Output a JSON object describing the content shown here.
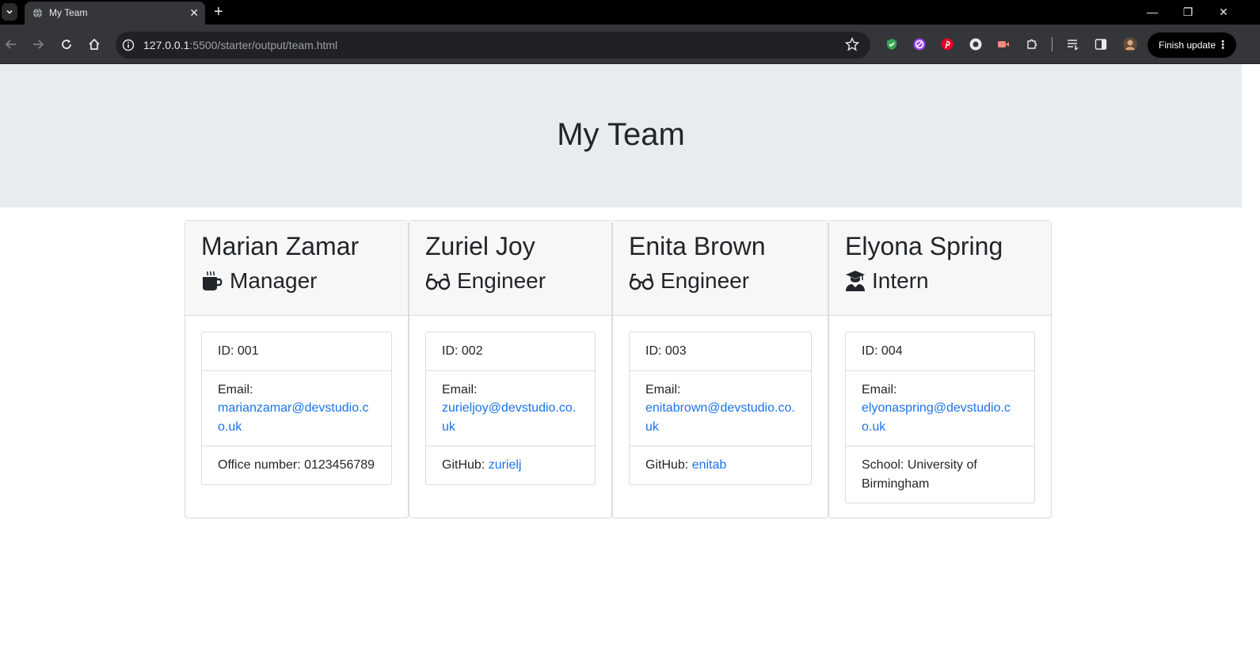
{
  "browser": {
    "tab_title": "My Team",
    "url_host": "127.0.0.1",
    "url_rest": ":5500/starter/output/team.html",
    "finish_update_label": "Finish update"
  },
  "page": {
    "title": "My Team"
  },
  "employees": [
    {
      "name": "Marian Zamar",
      "role": "Manager",
      "role_icon": "mug-icon",
      "id_label": "ID: 001",
      "email_label": "Email:",
      "email": "marianzamar@devstudio.co.uk",
      "extra_label": "Office number: 0123456789",
      "extra_link": ""
    },
    {
      "name": "Zuriel Joy",
      "role": "Engineer",
      "role_icon": "glasses-icon",
      "id_label": "ID: 002",
      "email_label": "Email:",
      "email": "zurieljoy@devstudio.co.uk",
      "extra_label": "GitHub: ",
      "extra_link": "zurielj"
    },
    {
      "name": "Enita Brown",
      "role": "Engineer",
      "role_icon": "glasses-icon",
      "id_label": "ID: 003",
      "email_label": "Email:",
      "email": "enitabrown@devstudio.co.uk",
      "extra_label": "GitHub: ",
      "extra_link": "enitab"
    },
    {
      "name": "Elyona Spring",
      "role": "Intern",
      "role_icon": "graduate-icon",
      "id_label": "ID: 004",
      "email_label": "Email:",
      "email": "elyonaspring@devstudio.co.uk",
      "extra_label": "School: University of Birmingham",
      "extra_link": ""
    }
  ],
  "colors": {
    "jumbotron_bg": "#e9ecef",
    "card_header_bg": "#f7f7f7",
    "link": "#1a73e8"
  }
}
